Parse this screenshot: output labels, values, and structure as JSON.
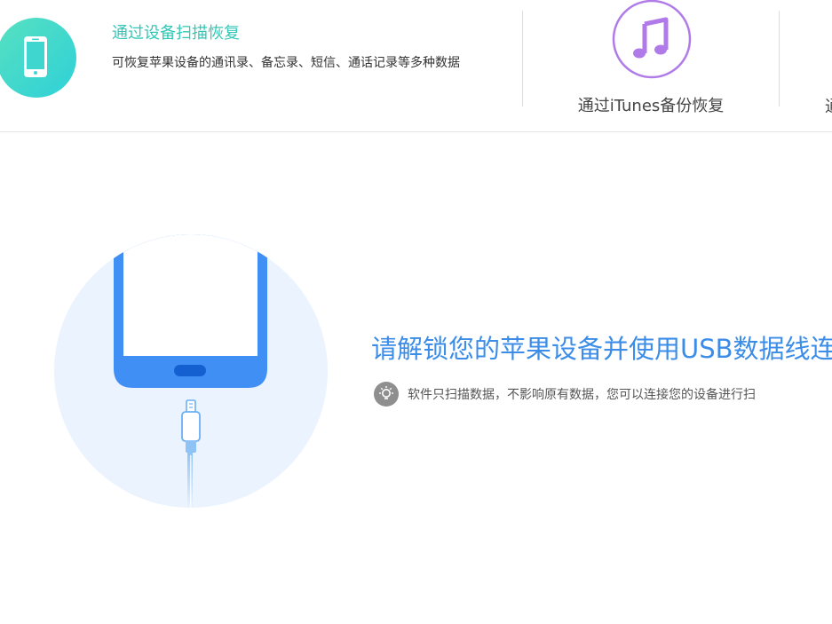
{
  "modes": {
    "device": {
      "title": "通过设备扫描恢复",
      "description": "可恢复苹果设备的通讯录、备忘录、短信、通话记录等多种数据",
      "icon": "phone-icon",
      "accent_color": "#33c7b6"
    },
    "itunes": {
      "label": "通过iTunes备份恢复",
      "icon": "music-note-icon",
      "accent_color": "#b07be8"
    },
    "third": {
      "label": "通"
    }
  },
  "main": {
    "connect_title": "请解锁您的苹果设备并使用USB数据线连",
    "tip_icon": "lightbulb-icon",
    "tip_text": "软件只扫描数据，不影响原有数据，您可以连接您的设备进行扫",
    "title_color": "#3b8de8"
  }
}
